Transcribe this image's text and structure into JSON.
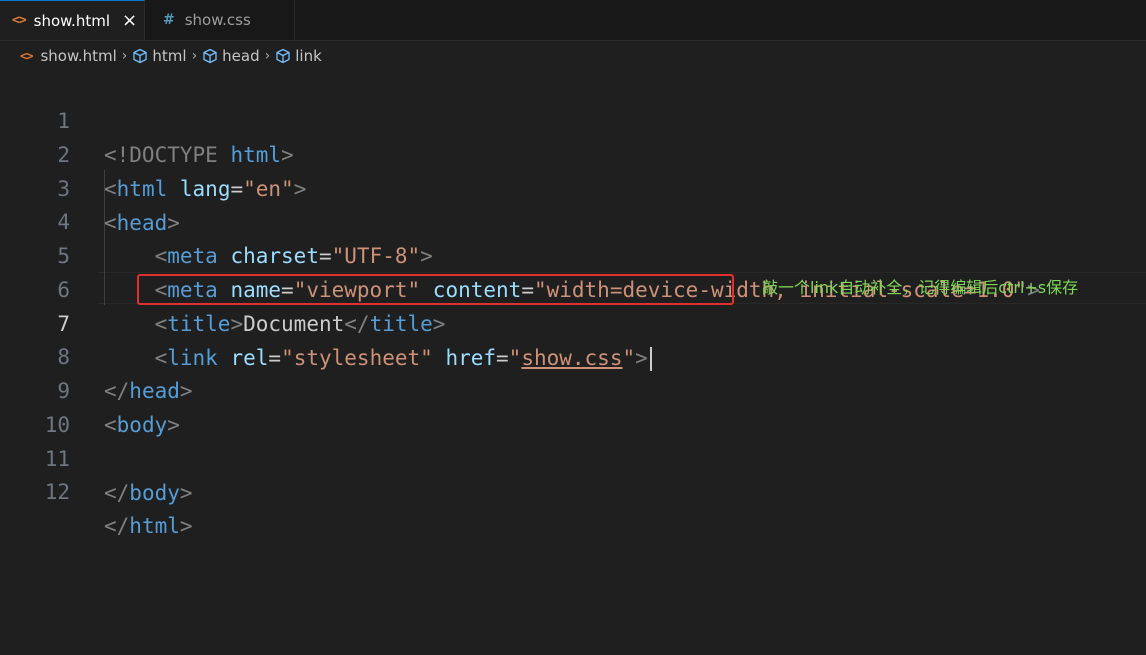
{
  "tabs": [
    {
      "label": "show.html",
      "icon": "html-file-icon",
      "close": "×",
      "active": true
    },
    {
      "label": "show.css",
      "icon": "css-file-icon",
      "active": false
    }
  ],
  "breadcrumb": {
    "file": "show.html",
    "items": [
      "html",
      "head",
      "link"
    ]
  },
  "editor": {
    "current_line": 7,
    "line_numbers": [
      "1",
      "2",
      "3",
      "4",
      "5",
      "6",
      "7",
      "8",
      "9",
      "10",
      "11",
      "12"
    ]
  },
  "code": {
    "l1": {
      "open": "<!DOCTYPE",
      "kw": "html",
      "close": ">"
    },
    "l2": {
      "open": "<",
      "tag": "html",
      "attr": "lang",
      "eq": "=",
      "val": "\"en\"",
      "close": ">"
    },
    "l3": {
      "open": "<",
      "tag": "head",
      "close": ">"
    },
    "l4": {
      "open": "<",
      "tag": "meta",
      "attr": "charset",
      "eq": "=",
      "val": "\"UTF-8\"",
      "close": ">"
    },
    "l5": {
      "open": "<",
      "tag": "meta",
      "attr1": "name",
      "eq1": "=",
      "val1": "\"viewport\"",
      "attr2": "content",
      "eq2": "=",
      "val2": "\"width=device-width, initial-scale=1.0\"",
      "close": ">"
    },
    "l6": {
      "open": "<",
      "tag": "title",
      "close": ">",
      "text": "Document",
      "open2": "</",
      "tag2": "title",
      "close2": ">"
    },
    "l7": {
      "open": "<",
      "tag": "link",
      "attr1": "rel",
      "eq1": "=",
      "val1": "\"stylesheet\"",
      "attr2": "href",
      "eq2": "=",
      "q1": "\"",
      "val2": "show.css",
      "q2": "\"",
      "close": ">"
    },
    "l8": {
      "open": "</",
      "tag": "head",
      "close": ">"
    },
    "l9": {
      "open": "<",
      "tag": "body",
      "close": ">"
    },
    "l11": {
      "open": "</",
      "tag": "body",
      "close": ">"
    },
    "l12": {
      "open": "</",
      "tag": "html",
      "close": ">"
    }
  },
  "annotation": "敲一个link自动补全，记得编辑后ctrl+s保存",
  "colors": {
    "background": "#1f1f1f",
    "tag": "#569cd6",
    "attribute": "#9cdcfe",
    "string": "#ce9178",
    "highlight_box": "#e03131",
    "annotation": "#7ed957"
  }
}
